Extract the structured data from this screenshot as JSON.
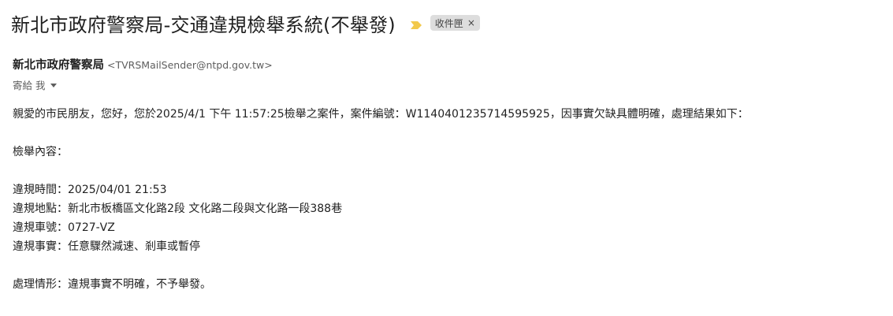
{
  "email": {
    "subject": "新北市政府警察局-交通違規檢舉系統(不舉發)",
    "label_chip": "收件匣",
    "label_remove": "×",
    "sender_name": "新北市政府警察局",
    "sender_email": "<TVRSMailSender@ntpd.gov.tw>",
    "recipient_text": "寄給 我",
    "importance_color": "#f2c94c"
  },
  "body": {
    "greeting": "親愛的市民朋友，您好，您於2025/4/1 下午 11:57:25檢舉之案件，案件編號：W1140401235714595925，因事實欠缺具體明確，處理結果如下：",
    "content_heading": "檢舉內容：",
    "violation_time": "違規時間：2025/04/01 21:53",
    "violation_location": "違規地點：新北市板橋區文化路2段 文化路二段與文化路一段388巷",
    "violation_plate": "違規車號：0727-VZ",
    "violation_fact": "違規事實：任意驟然減速、剎車或暫停",
    "result": "處理情形：違規事實不明確，不予舉發。"
  }
}
